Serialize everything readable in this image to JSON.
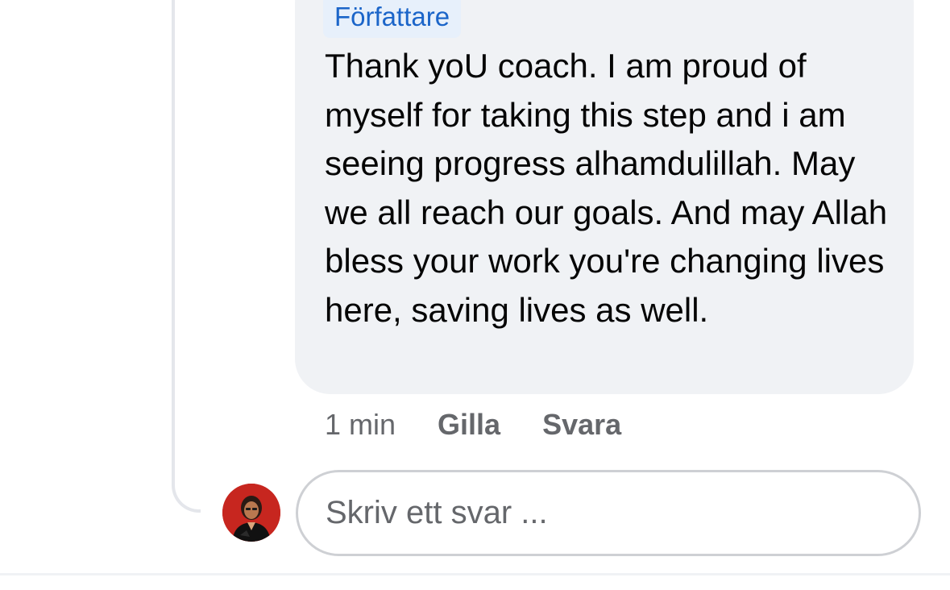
{
  "comment": {
    "author_badge": "Författare",
    "text": "Thank yoU coach. I am proud of myself for taking this step and i am seeing progress alhamdulillah. May we all reach our goals. And may Allah bless your work you're changing lives here, saving lives as well.",
    "time": "1 min",
    "like_label": "Gilla",
    "reply_label": "Svara"
  },
  "reply_box": {
    "placeholder": "Skriv ett svar ..."
  },
  "avatar": {
    "icon": "user-avatar",
    "background_color": "#c7261f"
  },
  "colors": {
    "bubble": "#f0f2f5",
    "badge_text": "#1b65c9",
    "badge_background": "#e7f0fb",
    "secondary_text": "#65676b"
  }
}
